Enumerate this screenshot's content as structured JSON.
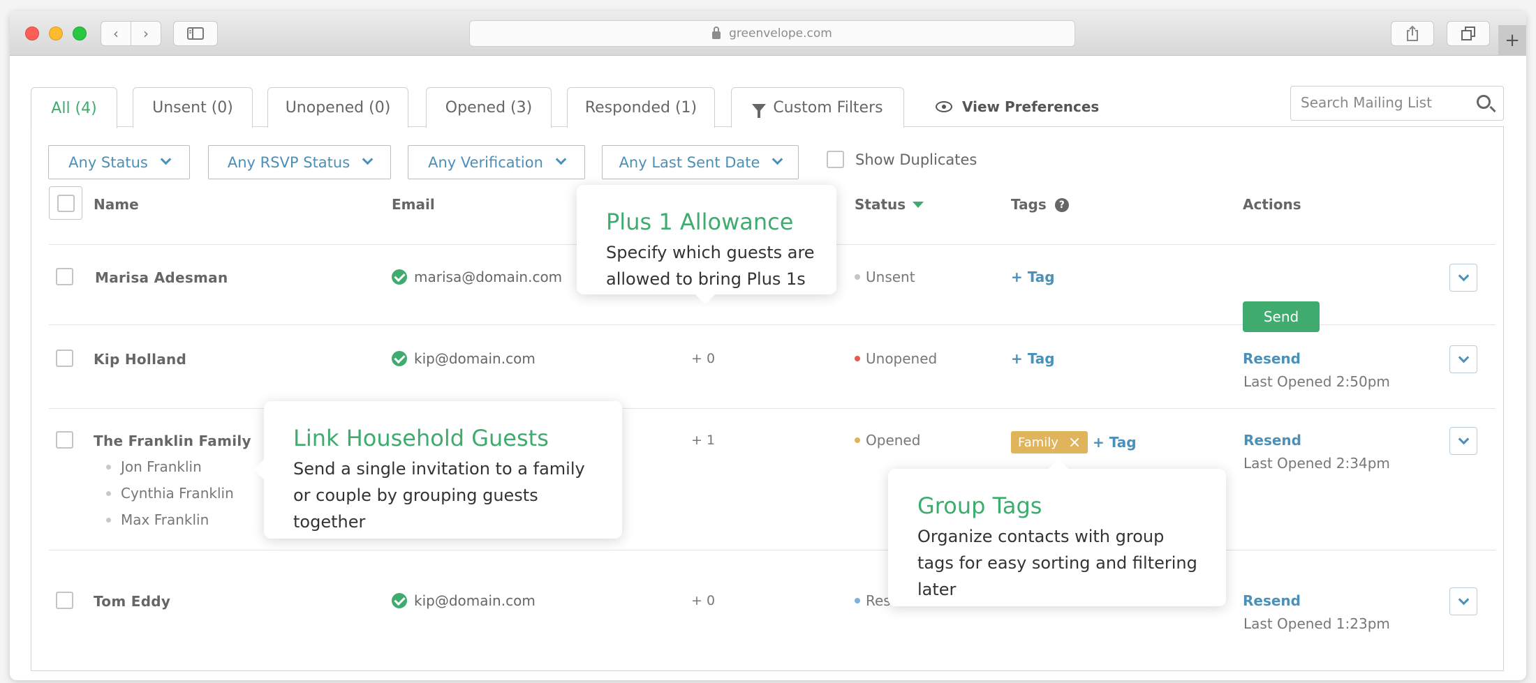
{
  "browser": {
    "url": "greenvelope.com"
  },
  "tabs": [
    {
      "label": "All (4)"
    },
    {
      "label": "Unsent (0)"
    },
    {
      "label": "Unopened (0)"
    },
    {
      "label": "Opened (3)"
    },
    {
      "label": "Responded (1)"
    },
    {
      "label": "Custom Filters"
    }
  ],
  "view_preferences": "View Preferences",
  "search": {
    "placeholder": "Search Mailing List"
  },
  "filters": [
    {
      "label": "Any Status"
    },
    {
      "label": "Any RSVP Status"
    },
    {
      "label": "Any Verification"
    },
    {
      "label": "Any Last Sent Date"
    }
  ],
  "show_duplicates": "Show Duplicates",
  "columns": {
    "name": "Name",
    "email": "Email",
    "status": "Status",
    "tags": "Tags",
    "actions": "Actions"
  },
  "tag_help": "?",
  "rows": [
    {
      "name": "Marisa Adesman",
      "email": "marisa@domain.com",
      "status": "Unsent",
      "status_color": "#c6c6c6",
      "tag_add": "+ Tag",
      "action": "Send"
    },
    {
      "name": "Kip Holland",
      "email": "kip@domain.com",
      "plus": "+ 0",
      "status": "Unopened",
      "status_color": "#e85a4f",
      "tag_add": "+ Tag",
      "action": "Resend",
      "last_opened": "Last Opened 2:50pm"
    },
    {
      "name": "The Franklin Family",
      "members": [
        "Jon Franklin",
        "Cynthia Franklin",
        "Max Franklin"
      ],
      "plus": "+ 1",
      "status": "Opened",
      "status_color": "#e0b45a",
      "tag": "Family",
      "tag_add": "+ Tag",
      "action": "Resend",
      "last_opened": "Last Opened 2:34pm"
    },
    {
      "name": "Tom Eddy",
      "email": "kip@domain.com",
      "plus": "+ 0",
      "status": "Res",
      "status_color": "#7fb0dc",
      "action": "Resend",
      "last_opened": "Last Opened 1:23pm"
    }
  ],
  "tooltips": {
    "plus1": {
      "title": "Plus 1 Allowance",
      "text": "Specify which guests are allowed to bring Plus 1s"
    },
    "household": {
      "title": "Link Household Guests",
      "text": "Send a single invitation to a family or couple by grouping guests together"
    },
    "tags": {
      "title": "Group Tags",
      "text": "Organize contacts with group tags for easy sorting and filtering later"
    }
  },
  "colors": {
    "accent_green": "#3fab6e",
    "link_blue": "#4a90b8",
    "tag_gold": "#e0b45a"
  }
}
